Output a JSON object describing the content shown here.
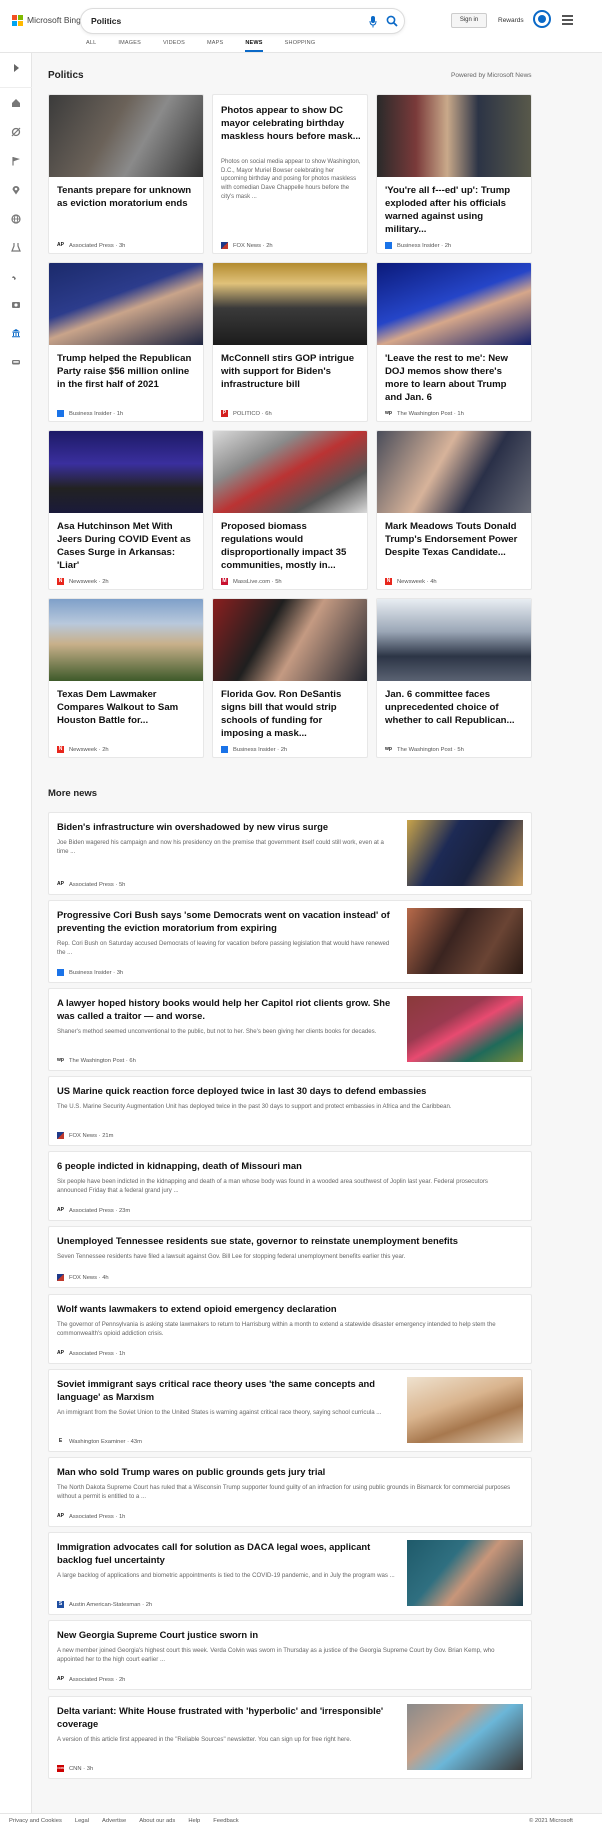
{
  "header": {
    "logo_text": "Microsoft Bing",
    "search_value": "Politics",
    "signin_label": "Sign in",
    "rewards_label": "Rewards",
    "tabs": [
      "ALL",
      "IMAGES",
      "VIDEOS",
      "MAPS",
      "NEWS",
      "SHOPPING"
    ],
    "active_tab": "NEWS"
  },
  "colors": {
    "accent": "#0a69c7",
    "ms_red": "#f25022",
    "ms_green": "#7fba00",
    "ms_blue": "#00a4ef",
    "ms_yellow": "#ffb900"
  },
  "rail_icons": [
    "expand-icon",
    "home-icon",
    "sports-icon",
    "flag-icon",
    "location-icon",
    "globe-icon",
    "science-icon",
    "rocket-icon",
    "money-icon",
    "politics-icon",
    "car-icon"
  ],
  "section": {
    "title": "Politics",
    "powered_by": "Powered by Microsoft News",
    "cards": [
      {
        "title": "Tenants prepare for unknown as eviction moratorium ends",
        "source": "Associated Press",
        "time": "3h",
        "icon": "AP"
      },
      {
        "title": "Photos appear to show DC mayor celebrating birthday maskless hours before mask...",
        "desc": "Photos on social media appear to show Washington, D.C., Mayor Muriel Bowser celebrating her upcoming birthday and posing for photos maskless with comedian Dave Chappelle hours before the city's mask ...",
        "source": "FOX News",
        "time": "2h",
        "icon": "FOX"
      },
      {
        "title": "'You're all f---ed' up': Trump exploded after his officials warned against using military...",
        "source": "Business Insider",
        "time": "2h",
        "icon": "BI"
      },
      {
        "title": "Trump helped the Republican Party raise $56 million online in the first half of 2021",
        "source": "Business Insider",
        "time": "1h",
        "icon": "BI"
      },
      {
        "title": "McConnell stirs GOP intrigue with support for Biden's infrastructure bill",
        "source": "POLITICO",
        "time": "6h",
        "icon": "P"
      },
      {
        "title": "'Leave the rest to me': New DOJ memos show there's more to learn about Trump and Jan. 6",
        "source": "The Washington Post",
        "time": "1h",
        "icon": "WP"
      },
      {
        "title": "Asa Hutchinson Met With Jeers During COVID Event as Cases Surge in Arkansas: 'Liar'",
        "source": "Newsweek",
        "time": "2h",
        "icon": "N"
      },
      {
        "title": "Proposed biomass regulations would disproportionally impact 35 communities, mostly in...",
        "source": "MassLive.com",
        "time": "5h",
        "icon": "M"
      },
      {
        "title": "Mark Meadows Touts Donald Trump's Endorsement Power Despite Texas Candidate...",
        "source": "Newsweek",
        "time": "4h",
        "icon": "N"
      },
      {
        "title": "Texas Dem Lawmaker Compares Walkout to Sam Houston Battle for...",
        "source": "Newsweek",
        "time": "2h",
        "icon": "N"
      },
      {
        "title": "Florida Gov. Ron DeSantis signs bill that would strip schools of funding for imposing a mask...",
        "source": "Business Insider",
        "time": "2h",
        "icon": "BI"
      },
      {
        "title": "Jan. 6 committee faces unprecedented choice of whether to call Republican...",
        "source": "The Washington Post",
        "time": "5h",
        "icon": "WP"
      }
    ]
  },
  "more_news": {
    "title": "More news",
    "items": [
      {
        "title": "Biden's infrastructure win overshadowed by new virus surge",
        "desc": "Joe Biden wagered his campaign and now his presidency on the premise that government itself could still work, even at a time ...",
        "source": "Associated Press",
        "time": "5h",
        "icon": "AP"
      },
      {
        "title": "Progressive Cori Bush says 'some Democrats went on vacation instead' of preventing the eviction moratorium from expiring",
        "desc": "Rep. Cori Bush on Saturday accused Democrats of leaving for vacation before passing legislation that would have renewed the ...",
        "source": "Business Insider",
        "time": "3h",
        "icon": "BI"
      },
      {
        "title": "A lawyer hoped history books would help her Capitol riot clients grow. She was called a traitor — and worse.",
        "desc": "Shaner's method seemed unconventional to the public, but not to her. She's been giving her clients books for decades.",
        "source": "The Washington Post",
        "time": "6h",
        "icon": "WP"
      },
      {
        "title": "US Marine quick reaction force deployed twice in last 30 days to defend embassies",
        "desc": "The U.S. Marine Security Augmentation Unit has deployed twice in the past 30 days to support and protect embassies in Africa and the Caribbean.",
        "source": "FOX News",
        "time": "21m",
        "icon": "FOX"
      },
      {
        "title": "6 people indicted in kidnapping, death of Missouri man",
        "desc": "Six people have been indicted in the kidnapping and death of a man whose body was found in a wooded area southwest of Joplin last year. Federal prosecutors announced Friday that a federal grand jury ...",
        "source": "Associated Press",
        "time": "23m",
        "icon": "AP"
      },
      {
        "title": "Unemployed Tennessee residents sue state, governor to reinstate unemployment benefits",
        "desc": "Seven Tennessee residents have filed a lawsuit against Gov. Bill Lee for stopping federal unemployment benefits earlier this year.",
        "source": "FOX News",
        "time": "4h",
        "icon": "FOX"
      },
      {
        "title": "Wolf wants lawmakers to extend opioid emergency declaration",
        "desc": "The governor of Pennsylvania is asking state lawmakers to return to Harrisburg within a month to extend a statewide disaster emergency intended to help stem the commonwealth's opioid addiction crisis.",
        "source": "Associated Press",
        "time": "1h",
        "icon": "AP"
      },
      {
        "title": "Soviet immigrant says critical race theory uses 'the same concepts and language' as Marxism",
        "desc": "An immigrant from the Soviet Union to the United States is warning against critical race theory, saying school curricula ...",
        "source": "Washington Examiner",
        "time": "43m",
        "icon": "E"
      },
      {
        "title": "Man who sold Trump wares on public grounds gets jury trial",
        "desc": "The North Dakota Supreme Court has ruled that a Wisconsin Trump supporter found guilty of an infraction for using public grounds in Bismarck for commercial purposes without a permit is entitled to a ...",
        "source": "Associated Press",
        "time": "1h",
        "icon": "AP"
      },
      {
        "title": "Immigration advocates call for solution as DACA legal woes, applicant backlog fuel uncertainty",
        "desc": "A large backlog of applications and biometric appointments is tied to the COVID-19 pandemic, and in July the program was ...",
        "source": "Austin American-Statesman",
        "time": "2h",
        "icon": "S"
      },
      {
        "title": "New Georgia Supreme Court justice sworn in",
        "desc": "A new member joined Georgia's highest court this week. Verda Colvin was sworn in Thursday as a justice of the Georgia Supreme Court by Gov. Brian Kemp, who appointed her to the high court earlier ...",
        "source": "Associated Press",
        "time": "2h",
        "icon": "AP"
      },
      {
        "title": "Delta variant: White House frustrated with 'hyperbolic' and 'irresponsible' coverage",
        "desc": "A version of this article first appeared in the \"Reliable Sources\" newsletter. You can sign up for free right here.",
        "source": "CNN",
        "time": "3h",
        "icon": "CNN"
      }
    ]
  },
  "footer": {
    "links": [
      "Privacy and Cookies",
      "Legal",
      "Advertise",
      "About our ads",
      "Help",
      "Feedback"
    ],
    "copyright": "© 2021 Microsoft"
  }
}
